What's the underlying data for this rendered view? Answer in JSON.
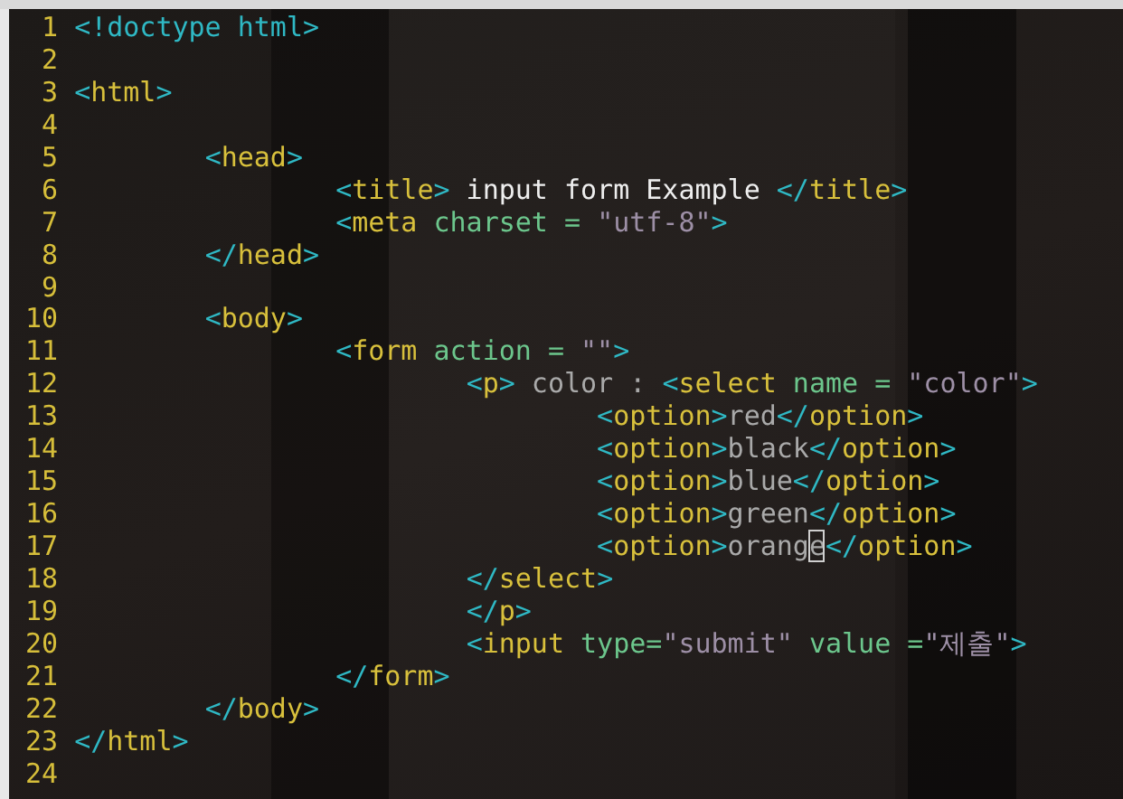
{
  "editor": {
    "lines": [
      {
        "number": "1",
        "tokens": [
          {
            "kind": "punct",
            "text": "<!doctype html>"
          }
        ]
      },
      {
        "number": "2"
      },
      {
        "number": "3",
        "tokens": [
          {
            "kind": "punct",
            "text": "<"
          },
          {
            "kind": "tag",
            "text": "html"
          },
          {
            "kind": "punct",
            "text": ">"
          }
        ]
      },
      {
        "number": "4"
      },
      {
        "number": "5",
        "tokens": [
          {
            "kind": "punct",
            "text": "\t<"
          },
          {
            "kind": "tag",
            "text": "head"
          },
          {
            "kind": "punct",
            "text": ">"
          }
        ]
      },
      {
        "number": "6",
        "tokens": [
          {
            "kind": "punct",
            "text": "\t\t<"
          },
          {
            "kind": "tag",
            "text": "title"
          },
          {
            "kind": "punct",
            "text": ">"
          },
          {
            "kind": "text",
            "text": " input form Example "
          },
          {
            "kind": "punct",
            "text": "</"
          },
          {
            "kind": "tag",
            "text": "title"
          },
          {
            "kind": "punct",
            "text": ">"
          }
        ]
      },
      {
        "number": "7",
        "tokens": [
          {
            "kind": "punct",
            "text": "\t\t<"
          },
          {
            "kind": "tag",
            "text": "meta"
          },
          {
            "kind": "attr",
            "text": " charset = "
          },
          {
            "kind": "string",
            "text": "\"utf-8\""
          },
          {
            "kind": "punct",
            "text": ">"
          }
        ]
      },
      {
        "number": "8",
        "tokens": [
          {
            "kind": "punct",
            "text": "\t</"
          },
          {
            "kind": "tag",
            "text": "head"
          },
          {
            "kind": "punct",
            "text": ">"
          }
        ]
      },
      {
        "number": "9"
      },
      {
        "number": "10",
        "tokens": [
          {
            "kind": "punct",
            "text": "\t<"
          },
          {
            "kind": "tag",
            "text": "body"
          },
          {
            "kind": "punct",
            "text": ">"
          }
        ]
      },
      {
        "number": "11",
        "tokens": [
          {
            "kind": "punct",
            "text": "\t\t<"
          },
          {
            "kind": "tag",
            "text": "form"
          },
          {
            "kind": "attr",
            "text": " action = "
          },
          {
            "kind": "string",
            "text": "\"\""
          },
          {
            "kind": "punct",
            "text": ">"
          }
        ]
      },
      {
        "number": "12",
        "tokens": [
          {
            "kind": "punct",
            "text": "\t\t\t<"
          },
          {
            "kind": "tag",
            "text": "p"
          },
          {
            "kind": "punct",
            "text": ">"
          },
          {
            "kind": "content",
            "text": " color : "
          },
          {
            "kind": "punct",
            "text": "<"
          },
          {
            "kind": "tag",
            "text": "select"
          },
          {
            "kind": "attr",
            "text": " name = "
          },
          {
            "kind": "string",
            "text": "\"color\""
          },
          {
            "kind": "punct",
            "text": ">"
          }
        ]
      },
      {
        "number": "13",
        "tokens": [
          {
            "kind": "punct",
            "text": "\t\t\t\t<"
          },
          {
            "kind": "tag",
            "text": "option"
          },
          {
            "kind": "punct",
            "text": ">"
          },
          {
            "kind": "content",
            "text": "red"
          },
          {
            "kind": "punct",
            "text": "</"
          },
          {
            "kind": "tag",
            "text": "option"
          },
          {
            "kind": "punct",
            "text": ">"
          }
        ]
      },
      {
        "number": "14",
        "tokens": [
          {
            "kind": "punct",
            "text": "\t\t\t\t<"
          },
          {
            "kind": "tag",
            "text": "option"
          },
          {
            "kind": "punct",
            "text": ">"
          },
          {
            "kind": "content",
            "text": "black"
          },
          {
            "kind": "punct",
            "text": "</"
          },
          {
            "kind": "tag",
            "text": "option"
          },
          {
            "kind": "punct",
            "text": ">"
          }
        ]
      },
      {
        "number": "15",
        "tokens": [
          {
            "kind": "punct",
            "text": "\t\t\t\t<"
          },
          {
            "kind": "tag",
            "text": "option"
          },
          {
            "kind": "punct",
            "text": ">"
          },
          {
            "kind": "content",
            "text": "blue"
          },
          {
            "kind": "punct",
            "text": "</"
          },
          {
            "kind": "tag",
            "text": "option"
          },
          {
            "kind": "punct",
            "text": ">"
          }
        ]
      },
      {
        "number": "16",
        "tokens": [
          {
            "kind": "punct",
            "text": "\t\t\t\t<"
          },
          {
            "kind": "tag",
            "text": "option"
          },
          {
            "kind": "punct",
            "text": ">"
          },
          {
            "kind": "content",
            "text": "green"
          },
          {
            "kind": "punct",
            "text": "</"
          },
          {
            "kind": "tag",
            "text": "option"
          },
          {
            "kind": "punct",
            "text": ">"
          }
        ]
      },
      {
        "number": "17",
        "tokens": [
          {
            "kind": "punct",
            "text": "\t\t\t\t<"
          },
          {
            "kind": "tag",
            "text": "option"
          },
          {
            "kind": "punct",
            "text": ">"
          },
          {
            "kind": "content",
            "text": "orang"
          },
          {
            "kind": "cursor",
            "text": "e"
          },
          {
            "kind": "punct",
            "text": "</"
          },
          {
            "kind": "tag",
            "text": "option"
          },
          {
            "kind": "punct",
            "text": ">"
          }
        ]
      },
      {
        "number": "18",
        "tokens": [
          {
            "kind": "punct",
            "text": "\t\t\t</"
          },
          {
            "kind": "tag",
            "text": "select"
          },
          {
            "kind": "punct",
            "text": ">"
          }
        ]
      },
      {
        "number": "19",
        "tokens": [
          {
            "kind": "punct",
            "text": "\t\t\t</"
          },
          {
            "kind": "tag",
            "text": "p"
          },
          {
            "kind": "punct",
            "text": ">"
          }
        ]
      },
      {
        "number": "20",
        "tokens": [
          {
            "kind": "punct",
            "text": "\t\t\t<"
          },
          {
            "kind": "tag",
            "text": "input"
          },
          {
            "kind": "attr",
            "text": " type="
          },
          {
            "kind": "string",
            "text": "\"submit\""
          },
          {
            "kind": "attr",
            "text": " value ="
          },
          {
            "kind": "string",
            "text": "\"제출\""
          },
          {
            "kind": "punct",
            "text": ">"
          }
        ]
      },
      {
        "number": "21",
        "tokens": [
          {
            "kind": "punct",
            "text": "\t\t</"
          },
          {
            "kind": "tag",
            "text": "form"
          },
          {
            "kind": "punct",
            "text": ">"
          }
        ]
      },
      {
        "number": "22",
        "tokens": [
          {
            "kind": "punct",
            "text": "\t</"
          },
          {
            "kind": "tag",
            "text": "body"
          },
          {
            "kind": "punct",
            "text": ">"
          }
        ]
      },
      {
        "number": "23",
        "tokens": [
          {
            "kind": "punct",
            "text": "</"
          },
          {
            "kind": "tag",
            "text": "html"
          },
          {
            "kind": "punct",
            "text": ">"
          }
        ]
      },
      {
        "number": "24"
      }
    ]
  }
}
